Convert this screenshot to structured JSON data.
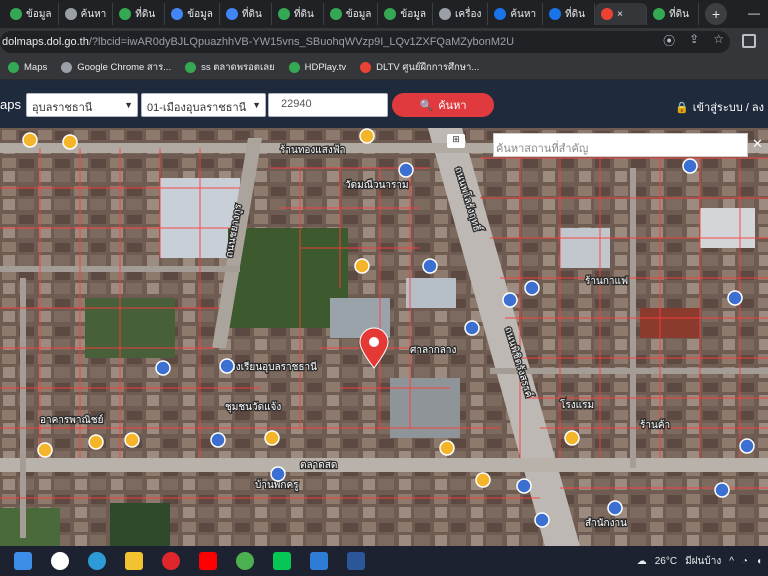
{
  "browser": {
    "tabs": [
      {
        "label": "ข้อมูล",
        "color": "#34a853"
      },
      {
        "label": "ค้นหา",
        "color": "#9aa0a6"
      },
      {
        "label": "ที่ดิน",
        "color": "#34a853"
      },
      {
        "label": "ข้อมูล",
        "color": "#4285f4"
      },
      {
        "label": "ที่ดิน",
        "color": "#4285f4"
      },
      {
        "label": "ที่ดิน",
        "color": "#34a853"
      },
      {
        "label": "ข้อมูล",
        "color": "#34a853"
      },
      {
        "label": "ข้อมูล",
        "color": "#34a853"
      },
      {
        "label": "เครื่อง",
        "color": "#9aa0a6"
      },
      {
        "label": "ค้นหา",
        "color": "#1a73e8"
      },
      {
        "label": "ที่ดิน",
        "color": "#1a73e8"
      },
      {
        "label": "×",
        "color": "#ea4335",
        "active": true
      },
      {
        "label": "ที่ดิน",
        "color": "#34a853"
      }
    ],
    "new_tab": "+",
    "window_ctrl": "—",
    "url_host": "dolmaps.dol.go.th",
    "url_path": "/?lbcid=iwAR0dyBJLQpuazhhVB-YW15vns_SBuohqWVzp9I_LQv1ZXFQaMZybonM2U",
    "bookmarks": [
      {
        "label": "Maps",
        "color": "#34a853"
      },
      {
        "label": "Google Chrome สาร...",
        "color": "#9aa0a6"
      },
      {
        "label": "ss ตลาดพรอตเลย",
        "color": "#34a853"
      },
      {
        "label": "HDPlay.tv",
        "color": "#34a853"
      },
      {
        "label": "DLTV ศูนย์ฝึกการศึกษา...",
        "color": "#ea4335"
      }
    ]
  },
  "app": {
    "logo_text": "aps",
    "province": "อุบลราชธานี",
    "district": "01-เมืองอุบลราชธานี",
    "zip": "22940",
    "search_label": "ค้นหา",
    "login_label": "เข้าสู่ระบบ / ลง"
  },
  "map": {
    "place_search_placeholder": "ค้นหาสถานที่สำคัญ",
    "close": "✕",
    "road_labels": [
      "ถนนพโลรังฤทธิ์",
      "ถนนชยางกูร",
      "ถนนพิชิตรังสรรค์"
    ],
    "place_labels": [
      "ร้านทองแสงฟ้า",
      "วัดมณีวนาราม",
      "โรงเรียนอุบลราชธานี",
      "ศาลากลาง",
      "ร้านกาแฟ",
      "ชุมชนวัดแจ้ง",
      "ตลาดสด",
      "โรงแรม",
      "ร้านค้า",
      "อาคารพาณิชย์",
      "บ้านพักครู",
      "สำนักงาน"
    ]
  },
  "taskbar": {
    "temperature": "26°C",
    "weather": "มีฝนบ้าง",
    "chevron": "^",
    "apps": [
      {
        "name": "start",
        "color": "#3d8ee6"
      },
      {
        "name": "search",
        "color": "#ffffff"
      },
      {
        "name": "edge",
        "color": "#2d9bd8"
      },
      {
        "name": "file-explorer",
        "color": "#f2c230"
      },
      {
        "name": "opera",
        "color": "#e0262d"
      },
      {
        "name": "youtube",
        "color": "#ff0000"
      },
      {
        "name": "chrome",
        "color": "#4caf50"
      },
      {
        "name": "line",
        "color": "#06c755"
      },
      {
        "name": "photos",
        "color": "#2e7cd6"
      },
      {
        "name": "word",
        "color": "#2b579a"
      }
    ]
  },
  "colors": {
    "header_bg": "#1f2b3d",
    "search_btn": "#e03a3e",
    "marker_red": "#e53935",
    "poi_yellow": "#f5b52a",
    "poi_blue": "#3b6fd1",
    "parcel_line": "#ff3b3b",
    "road": "#bdb8b3"
  }
}
